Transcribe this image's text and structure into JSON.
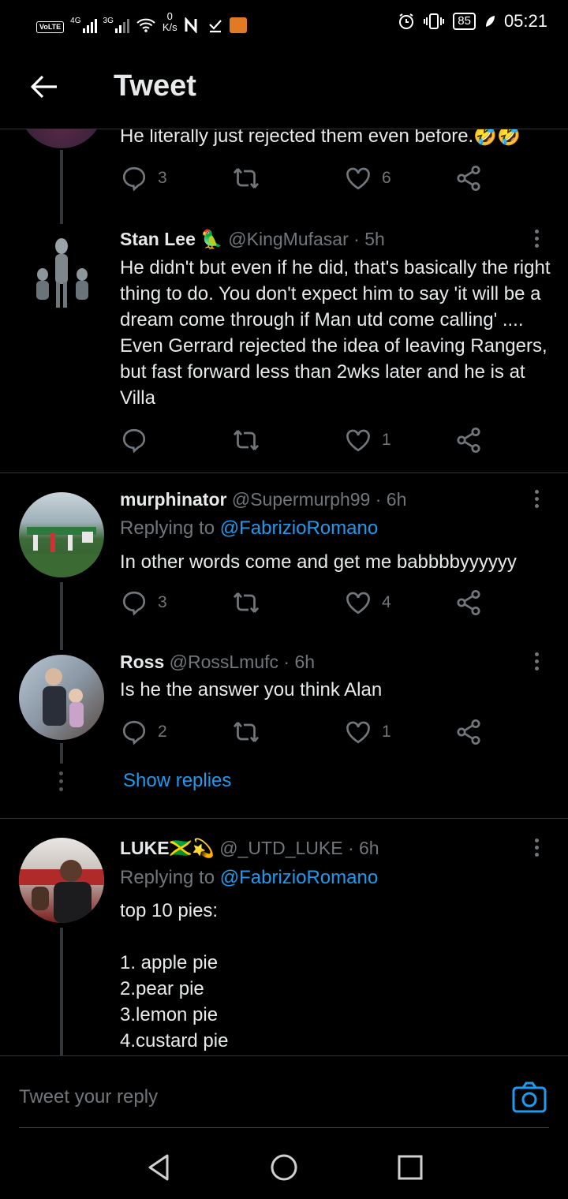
{
  "status_bar": {
    "volte": "VoLTE",
    "net1": "4G",
    "net2": "3G",
    "speed_value": "0",
    "speed_unit": "K/s",
    "battery": "85",
    "time": "05:21"
  },
  "header": {
    "title": "Tweet"
  },
  "tweets": [
    {
      "text": "He literally just rejected them even before.🤣🤣",
      "replies": "3",
      "retweets": "",
      "likes": "6"
    },
    {
      "name": "Stan Lee 🦜",
      "handle": "@KingMufasar · 5h",
      "text": "He didn't but even if he did, that's basically the right thing to do. You don't expect him to say 'it will be a dream come through if Man utd come calling' .... Even Gerrard rejected the idea of leaving Rangers, but fast forward less than 2wks later and he is at Villa",
      "replies": "",
      "retweets": "",
      "likes": "1"
    },
    {
      "name": "murphinator",
      "handle": "@Supermurph99 · 6h",
      "replying_prefix": "Replying to ",
      "replying_to": "@FabrizioRomano",
      "text": "In other words come and get me babbbbyyyyyy",
      "replies": "3",
      "retweets": "",
      "likes": "4"
    },
    {
      "name": "Ross",
      "handle": "@RossLmufc · 6h",
      "text": "Is he the answer you think Alan",
      "replies": "2",
      "retweets": "",
      "likes": "1"
    },
    {
      "name": "LUKE🇯🇲💫",
      "handle": "@_UTD_LUKE · 6h",
      "replying_prefix": "Replying to ",
      "replying_to": "@FabrizioRomano",
      "text": "top 10 pies:\n\n1. apple pie\n2.pear pie\n3.lemon pie\n4.custard pie"
    }
  ],
  "show_replies": "Show replies",
  "compose": {
    "placeholder": "Tweet your reply"
  },
  "icons": {
    "reply": "reply-icon",
    "retweet": "retweet-icon",
    "like": "heart-icon",
    "share": "share-icon",
    "back": "back-arrow-icon",
    "camera": "camera-icon"
  },
  "colors": {
    "accent": "#1d9bf0",
    "background": "#000000",
    "muted": "#71767b"
  }
}
